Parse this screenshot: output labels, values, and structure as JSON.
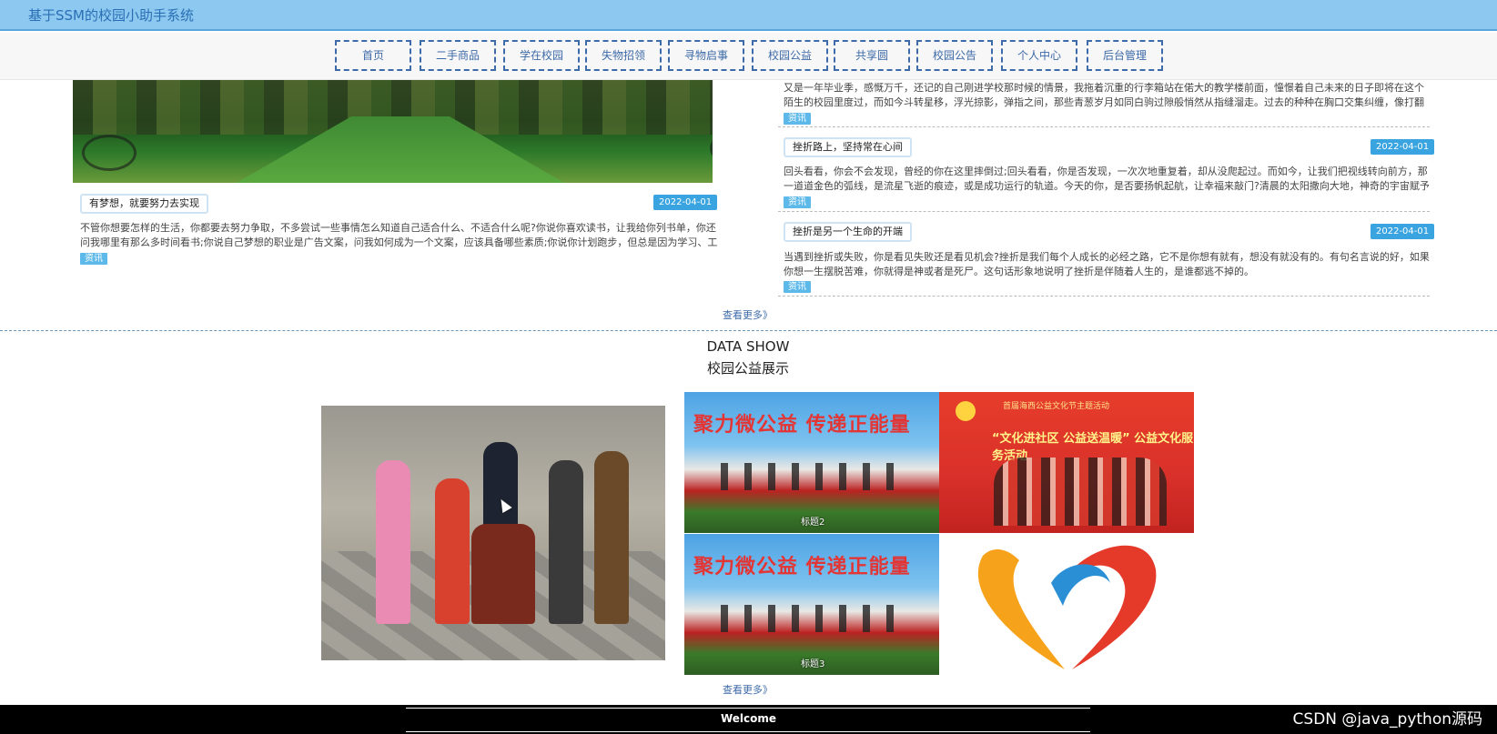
{
  "app": {
    "title": "基于SSM的校园小助手系统"
  },
  "nav": [
    "首页",
    "二手商品",
    "学在校园",
    "失物招领",
    "寻物启事",
    "校园公益",
    "共享圆",
    "校园公告",
    "个人中心",
    "后台管理"
  ],
  "news_left": {
    "title": "有梦想，就要努力去实现",
    "date": "2022-04-01",
    "excerpt": "不管你想要怎样的生活，你都要去努力争取，不多尝试一些事情怎么知道自己适合什么、不适合什么呢?你说你喜欢读书，让我给你列书单，你还问我哪里有那么多时间看书;你说自己梦想的职业是广告文案，问我如何成为一个文案，应该具备哪些素质;你说你计划跑步，但总是因为学习、工作…",
    "badge": "资讯"
  },
  "news_right": [
    {
      "title": "",
      "date": "",
      "excerpt": "又是一年毕业季，感慨万千，还记的自己刚进学校那时候的情景，我拖着沉重的行李箱站在偌大的教学楼前面，憧憬着自己未来的日子即将在这个陌生的校园里度过，而如今斗转星移，浮光掠影，弹指之间，那些青葱岁月如同白驹过隙般悄然从指缝溜走。过去的种种在胸口交集纠缠，像打翻的五味…",
      "badge": "资讯"
    },
    {
      "title": "挫折路上，坚持常在心间",
      "date": "2022-04-01",
      "excerpt": "回头看看，你会不会发现，曾经的你在这里摔倒过;回头看看，你是否发现，一次次地重复着，却从没爬起过。而如今，让我们把视线转向前方，那一道道金色的弧线，是流星飞逝的痕迹，或是成功运行的轨道。今天的你，是否要扬帆起航，让幸福来敲门?清晨的太阳撒向大地，神奇的宇宙赋予它…",
      "badge": "资讯"
    },
    {
      "title": "挫折是另一个生命的开端",
      "date": "2022-04-01",
      "excerpt": "当遇到挫折或失败，你是看见失败还是看见机会?挫折是我们每个人成长的必经之路，它不是你想有就有，想没有就没有的。有句名言说的好，如果你想一生摆脱苦难，你就得是神或者是死尸。这句话形象地说明了挫折是伴随着人生的，是谁都逃不掉的。",
      "badge": "资讯"
    }
  ],
  "more_label": "查看更多》",
  "datashow": {
    "title_en": "DATA SHOW",
    "title_cn": "校园公益展示"
  },
  "gallery": {
    "banner_text": "聚力微公益  传递正能量",
    "captions": [
      "标题2",
      "标题3"
    ],
    "poster_line1": "首届海西公益文化节主题活动",
    "poster_line2": "“文化进社区  公益送温暖” 公益文化服务活动"
  },
  "footer": {
    "welcome": "Welcome"
  },
  "watermark": "CSDN @java_python源码",
  "colors": {
    "topbar": "#8cc8ef",
    "nav_border": "#3d6aa8",
    "date_badge": "#39a4e0",
    "badge": "#5db9ea"
  }
}
